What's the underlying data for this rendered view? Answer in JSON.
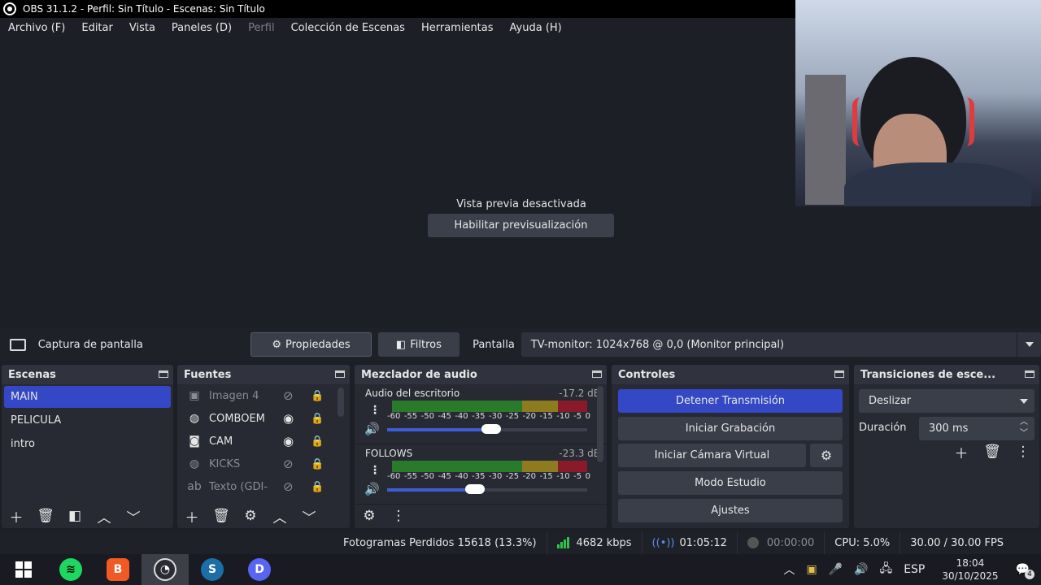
{
  "window": {
    "title": "OBS 31.1.2 - Perfil: Sin Título - Escenas: Sin Título"
  },
  "menu": [
    "Archivo (F)",
    "Editar",
    "Vista",
    "Paneles (D)",
    "Perfil",
    "Colección de Escenas",
    "Herramientas",
    "Ayuda (H)"
  ],
  "preview": {
    "message": "Vista previa desactivada",
    "enable_label": "Habilitar previsualización"
  },
  "source_toolbar": {
    "source_name": "Captura de pantalla",
    "properties_label": "Propiedades",
    "filters_label": "Filtros",
    "screen_label": "Pantalla",
    "monitor_value": "TV-monitor: 1024x768 @ 0,0 (Monitor principal)"
  },
  "scenes": {
    "title": "Escenas",
    "items": [
      "MAIN",
      "PELICULA",
      "intro"
    ]
  },
  "sources": {
    "title": "Fuentes",
    "items": [
      {
        "name": "Imagen 4",
        "icon": "image-icon"
      },
      {
        "name": "COMBOEM",
        "icon": "browser-icon"
      },
      {
        "name": "CAM",
        "icon": "camera-icon"
      },
      {
        "name": "KICKS",
        "icon": "browser-icon"
      },
      {
        "name": "Texto (GDI-",
        "icon": "text-icon"
      }
    ]
  },
  "mixer": {
    "title": "Mezclador de audio",
    "ticks": [
      "-60",
      "-55",
      "-50",
      "-45",
      "-40",
      "-35",
      "-30",
      "-25",
      "-20",
      "-15",
      "-10",
      "-5",
      "0"
    ],
    "channels": [
      {
        "name": "Audio del escritorio",
        "db": "-17.2 dB",
        "volume": 0.52
      },
      {
        "name": "FOLLOWS",
        "db": "-23.3 dB",
        "volume": 0.44
      }
    ]
  },
  "controls": {
    "title": "Controles",
    "stop_stream": "Detener Transmisión",
    "start_recording": "Iniciar Grabación",
    "virtual_cam": "Iniciar Cámara Virtual",
    "studio_mode": "Modo Estudio",
    "settings": "Ajustes"
  },
  "transitions": {
    "title": "Transiciones de esce...",
    "selected": "Deslizar",
    "duration_label": "Duración",
    "duration_value": "300 ms"
  },
  "status": {
    "dropped": "Fotogramas Perdidos 15618 (13.3%)",
    "bitrate": "4682 kbps",
    "stream_time": "01:05:12",
    "rec_time": "00:00:00",
    "cpu": "CPU: 5.0%",
    "fps": "30.00 / 30.00 FPS"
  },
  "taskbar": {
    "lang": "ESP",
    "time": "18:04",
    "date": "30/10/2025",
    "notifications": "4"
  },
  "colors": {
    "accent": "#3447c4",
    "panel": "#272a33",
    "background": "#1d1f26"
  }
}
